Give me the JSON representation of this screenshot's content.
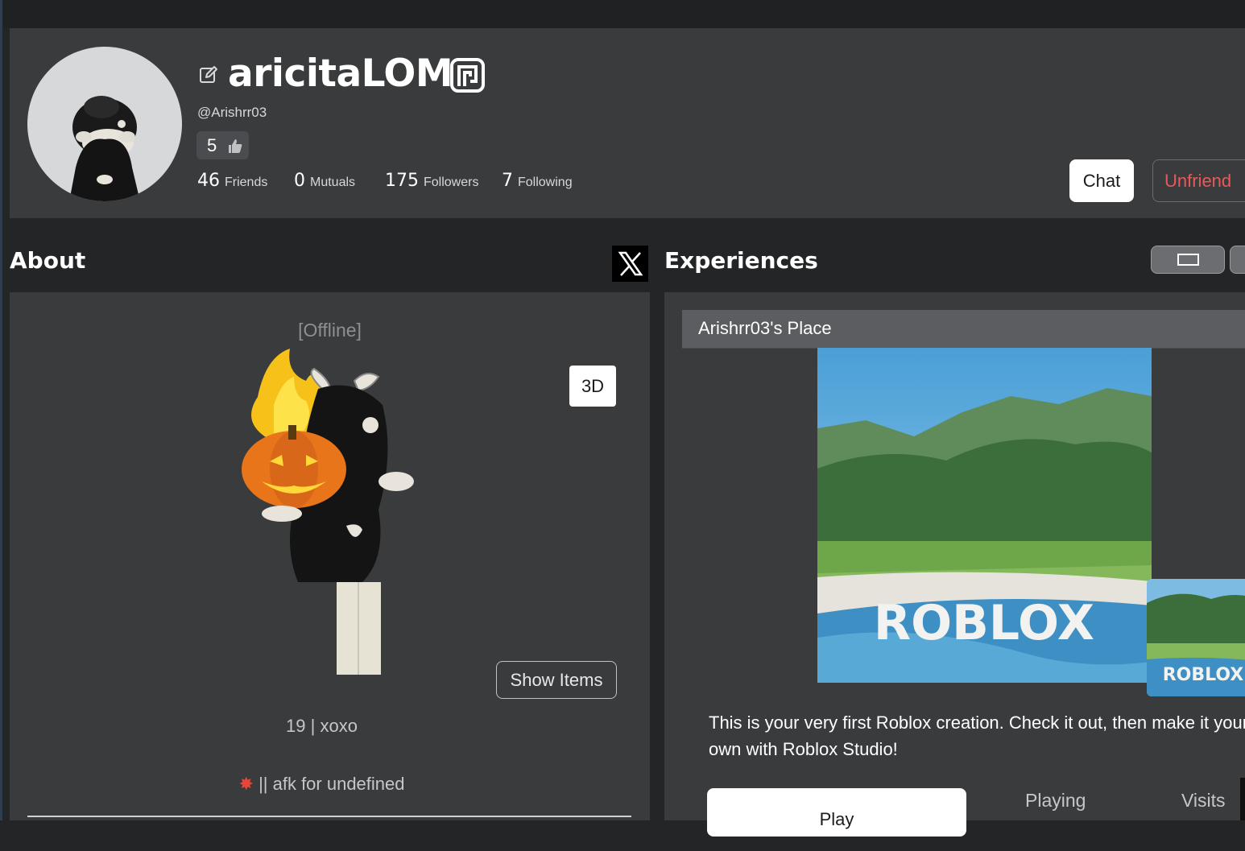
{
  "profile": {
    "display_name": "aricitaLOM",
    "username": "@Arishrr03",
    "rating": "5",
    "stats": [
      {
        "count": "46",
        "label": "Friends"
      },
      {
        "count": "0",
        "label": "Mutuals"
      },
      {
        "count": "175",
        "label": "Followers"
      },
      {
        "count": "7",
        "label": "Following"
      }
    ],
    "chat_label": "Chat",
    "unfriend_label": "Unfriend"
  },
  "about": {
    "title": "About",
    "status": "[Offline]",
    "btn_3d": "3D",
    "show_items": "Show Items",
    "bio_line1": "19 | xoxo",
    "bio_line2": "|| afk for undefined"
  },
  "experiences": {
    "title": "Experiences",
    "place_name": "Arishrr03's Place",
    "thumbnail_text": "ROBLOX",
    "description": "This is your very first Roblox creation. Check it out, then make it your own with Roblox Studio!",
    "play_label": "Play",
    "playing_label": "Playing",
    "visits_label": "Visits"
  },
  "icons": {
    "edit": "edit-icon",
    "premium": "premium-icon",
    "thumb": "thumbs-up-icon",
    "x": "x-social-icon",
    "bio_emoji": "collision-icon"
  },
  "colors": {
    "header_bg": "#393b3d",
    "page_bg": "#232527",
    "unfriend_text": "#e85a5a"
  }
}
